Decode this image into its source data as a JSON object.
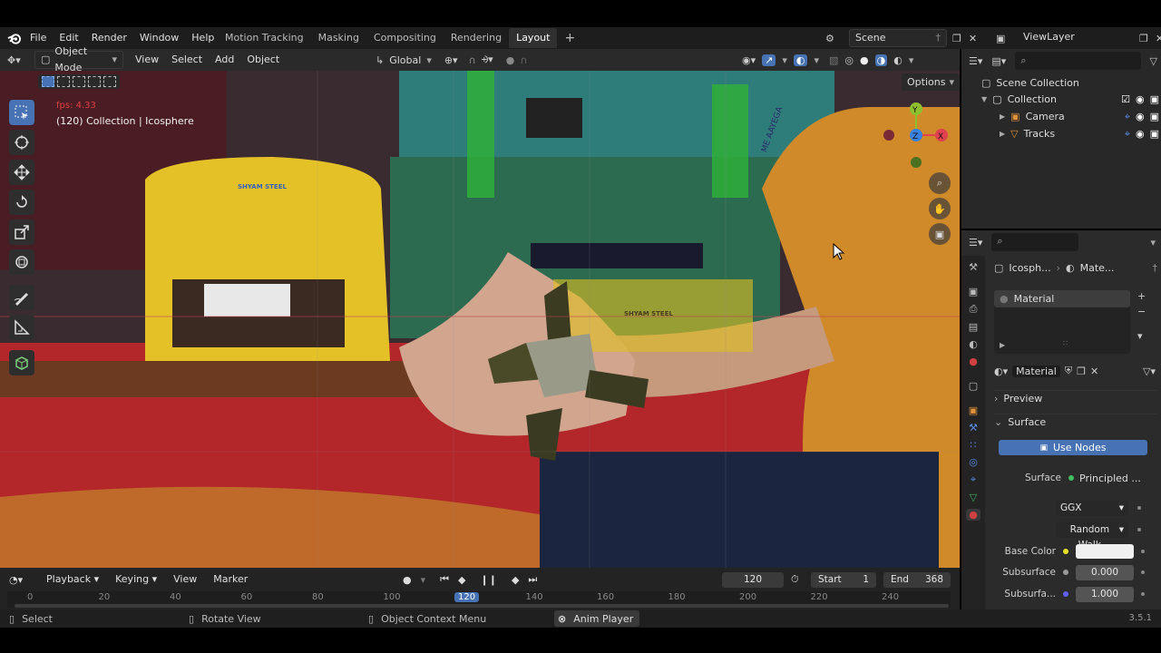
{
  "menubar": {
    "items": [
      "File",
      "Edit",
      "Render",
      "Window",
      "Help"
    ]
  },
  "workspaces": {
    "tabs": [
      "Motion Tracking",
      "Masking",
      "Compositing",
      "Rendering",
      "Layout"
    ],
    "active": "Layout",
    "add": "+"
  },
  "scene": {
    "name": "Scene"
  },
  "viewlayer": {
    "name": "ViewLayer"
  },
  "viewport_header": {
    "mode": "Object Mode",
    "menus": [
      "View",
      "Select",
      "Add",
      "Object"
    ],
    "transform_orientation": "Global",
    "options_label": "Options"
  },
  "viewport": {
    "overlay_frame_text": "(120) Collection | Icosphere",
    "overlay_red_text": "fps: 4.33",
    "backdrop_texts": {
      "chair_brand": "SHYAM STEEL",
      "right_chair_brand": "SHYAM STEEL",
      "shirt_text": "ME AAYEGA"
    }
  },
  "outliner": {
    "root": "Scene Collection",
    "collection": "Collection",
    "items": [
      {
        "label": "Camera",
        "icon": "camera-icon"
      },
      {
        "label": "Tracks",
        "icon": "tracks-icon"
      }
    ]
  },
  "properties": {
    "breadcrumb_object": "Icosph...",
    "breadcrumb_material": "Mate...",
    "slot_label": "Material",
    "material_name": "Material",
    "sections": {
      "preview": "Preview",
      "surface": "Surface"
    },
    "use_nodes": "Use Nodes",
    "surface_label": "Surface",
    "surface_value": "Principled ...",
    "distribution": "GGX",
    "subsurface_method": "Random Walk",
    "fields": [
      {
        "label": "Base Color",
        "value": "",
        "dot": "#e8e020"
      },
      {
        "label": "Subsurface",
        "value": "0.000",
        "dot": "#999999"
      },
      {
        "label": "Subsurfa...",
        "value": "1.000",
        "dot": "#6060ff"
      }
    ]
  },
  "timeline": {
    "menus": [
      "Playback",
      "Keying",
      "View",
      "Marker"
    ],
    "current_frame": "120",
    "start_label": "Start",
    "start_value": "1",
    "end_label": "End",
    "end_value": "368",
    "ruler": [
      "0",
      "20",
      "40",
      "60",
      "80",
      "100",
      "120",
      "140",
      "160",
      "180",
      "200",
      "220",
      "240"
    ],
    "ruler_active": "120"
  },
  "statusbar": {
    "select": "Select",
    "rotate": "Rotate View",
    "context": "Object Context Menu",
    "anim_player": "Anim Player",
    "version": "3.5.1"
  },
  "colors": {
    "accent": "#4772b3",
    "active_frame": "#4772b3",
    "axis_x": "#e04050",
    "axis_y": "#8fc030",
    "axis_z": "#3a80e0"
  }
}
